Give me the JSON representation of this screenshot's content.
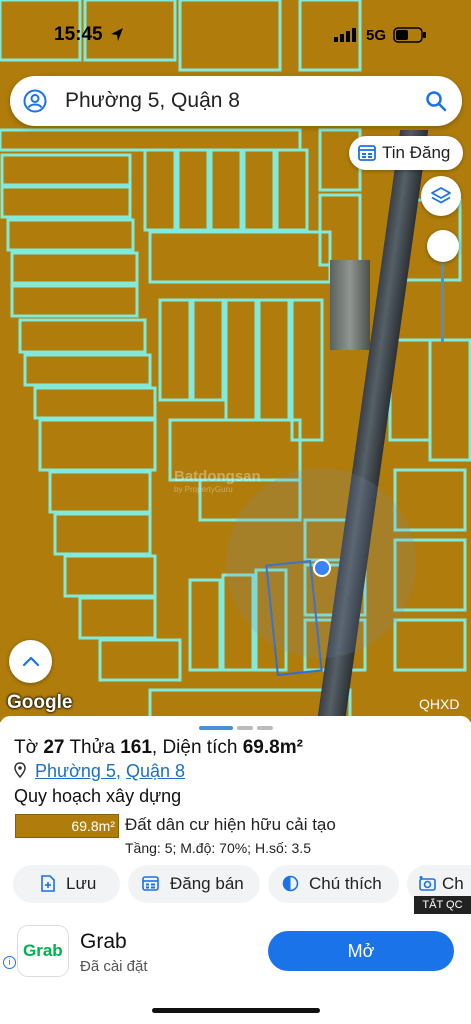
{
  "status": {
    "time": "15:45",
    "network": "5G"
  },
  "search": {
    "placeholder": "Phường 5, Quận 8"
  },
  "map": {
    "tin_dang_label": "Tin Đăng",
    "attribution": "Google",
    "layer_label": "QHXD",
    "watermark": "Batdongsan",
    "watermark_sub": "by PropertyGuru",
    "zone_color": "#b07d0c",
    "boundary_color": "#7ff0e6"
  },
  "parcel": {
    "to_label": "Tờ",
    "to_value": "27",
    "thua_label": "Thửa",
    "thua_value": "161",
    "area_label": "Diện tích",
    "area_value": "69.8m²",
    "ward": "Phường 5",
    "district": "Quận 8",
    "planning_heading": "Quy hoạch xây dựng",
    "zone_area": "69.8m²",
    "zone_desc": "Đất dân cư hiện hữu cải tạo",
    "zone_params": "Tầng: 5; M.độ: 70%; H.số: 3.5"
  },
  "actions": [
    {
      "label": "Lưu",
      "icon": "add-document-icon"
    },
    {
      "label": "Đăng bán",
      "icon": "listing-icon"
    },
    {
      "label": "Chú thích",
      "icon": "contrast-icon"
    },
    {
      "label": "Ch",
      "icon": "camera-icon"
    }
  ],
  "ad": {
    "close_label": "TẮT QC",
    "app_name": "Grab",
    "status": "Đã cài đặt",
    "cta": "Mở",
    "logo_text": "Grab"
  }
}
